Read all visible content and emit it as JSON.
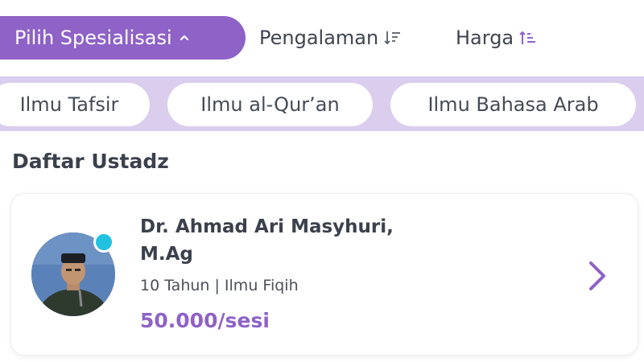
{
  "filters": {
    "specialization_label": "Pilih Spesialisasi",
    "experience_label": "Pengalaman",
    "price_label": "Harga"
  },
  "chips": [
    {
      "label": "Ilmu Tafsir"
    },
    {
      "label": "Ilmu al-Qur’an"
    },
    {
      "label": "Ilmu Bahasa Arab"
    }
  ],
  "section_title": "Daftar Ustadz",
  "ustadz_list": [
    {
      "name": "Dr. Ahmad Ari Masyhuri, M.Ag",
      "experience_specialty": "10 Tahun | Ilmu Fiqih",
      "price": "50.000/sesi",
      "online": true
    }
  ],
  "colors": {
    "accent": "#8e62c7",
    "chip_band": "#dbcdee",
    "online": "#22c1e0"
  },
  "icons": {
    "specialization_toggle": "chevron-up-icon",
    "experience_sort": "sort-descending-icon",
    "price_sort": "sort-ascending-icon",
    "card_open": "chevron-right-icon"
  }
}
